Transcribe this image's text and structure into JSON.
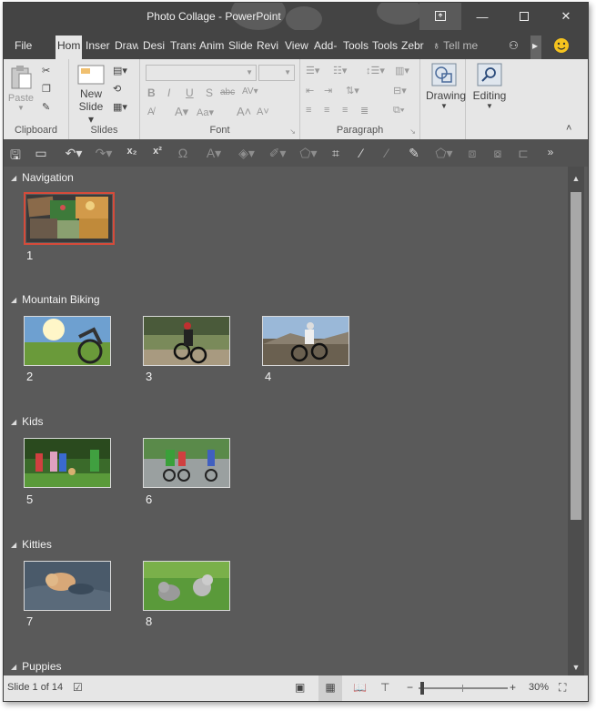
{
  "window": {
    "title": "Photo Collage - PowerPoint"
  },
  "tabs": [
    "File",
    "Hom",
    "Inser",
    "Draw",
    "Desi",
    "Trans",
    "Anim",
    "Slide",
    "Revi",
    "View",
    "Add-",
    "Tools",
    "Tools",
    "Zebr"
  ],
  "tell_me": "Tell me",
  "ribbon": {
    "clipboard": {
      "label": "Clipboard",
      "paste": "Paste"
    },
    "slides": {
      "label": "Slides",
      "new_slide_1": "New",
      "new_slide_2": "Slide"
    },
    "font": {
      "label": "Font",
      "bold": "B",
      "italic": "I",
      "underline": "U",
      "shadow": "S",
      "strike": "abc",
      "spacing": "AV",
      "font_color": "A",
      "size_a": "Aa",
      "grow": "A",
      "shrink": "A"
    },
    "paragraph": {
      "label": "Paragraph"
    },
    "drawing": {
      "label": "Drawing"
    },
    "editing": {
      "label": "Editing"
    }
  },
  "sections": [
    {
      "name": "Navigation",
      "slides": [
        1
      ]
    },
    {
      "name": "Mountain Biking",
      "slides": [
        2,
        3,
        4
      ]
    },
    {
      "name": "Kids",
      "slides": [
        5,
        6
      ]
    },
    {
      "name": "Kitties",
      "slides": [
        7,
        8
      ]
    },
    {
      "name": "Puppies",
      "slides": []
    }
  ],
  "slide_numbers": [
    "1",
    "2",
    "3",
    "4",
    "5",
    "6",
    "7",
    "8"
  ],
  "status": {
    "slide_info": "Slide 1 of 14",
    "zoom": "30%"
  },
  "colors": {
    "selection": "#d64b3a",
    "pane_bg": "#5a5a5a",
    "ribbon_bg": "#e6e6e6",
    "title_bg": "#444444"
  }
}
